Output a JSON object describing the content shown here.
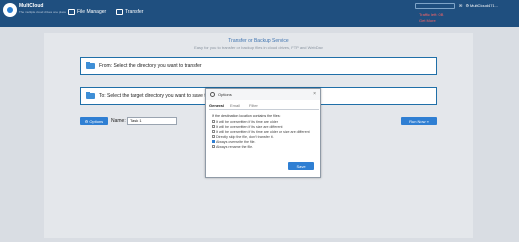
{
  "header": {
    "brand": "MultCloud",
    "brand_sub": "The multiple cloud drives one place",
    "nav": [
      {
        "label": "File Manager",
        "icon": "folder-icon"
      },
      {
        "label": "Transfer",
        "icon": "transfer-icon"
      }
    ],
    "account": "MultCloud471...",
    "notice_1": "Traffic left: 0B",
    "notice_2": "Get More",
    "icons_text": "✉ ⚙"
  },
  "main": {
    "title": "Transfer or Backup Service",
    "subtitle": "Easy for you to transfer or backup files in cloud drives, FTP and WebDav",
    "source_text": "From: Select the directory you want to transfer",
    "target_text": "To: Select the target directory you want to save the...",
    "options_label": "Options",
    "name_label": "Name:",
    "name_value": "Task 1",
    "run_label": "Run Now »"
  },
  "dialog": {
    "title": "Options",
    "close": "×",
    "tabs": [
      "General",
      "Email",
      "Filter"
    ],
    "label": "If the destination location contains the files:",
    "options": [
      {
        "text": "It will be overwritten if its time are older",
        "checked": false
      },
      {
        "text": "It will be overwritten if its size are different",
        "checked": false
      },
      {
        "text": "It will be overwritten if its time are older or size are different",
        "checked": false
      },
      {
        "text": "Directly skip the file, don't transfer it.",
        "checked": false
      },
      {
        "text": "Always overwrite the file.",
        "checked": true
      },
      {
        "text": "Always rename the file.",
        "checked": false
      }
    ],
    "save_label": "Save"
  },
  "colors": {
    "header": "#1f4f7f",
    "accent": "#2f7fd3",
    "warning": "#ff6464"
  }
}
